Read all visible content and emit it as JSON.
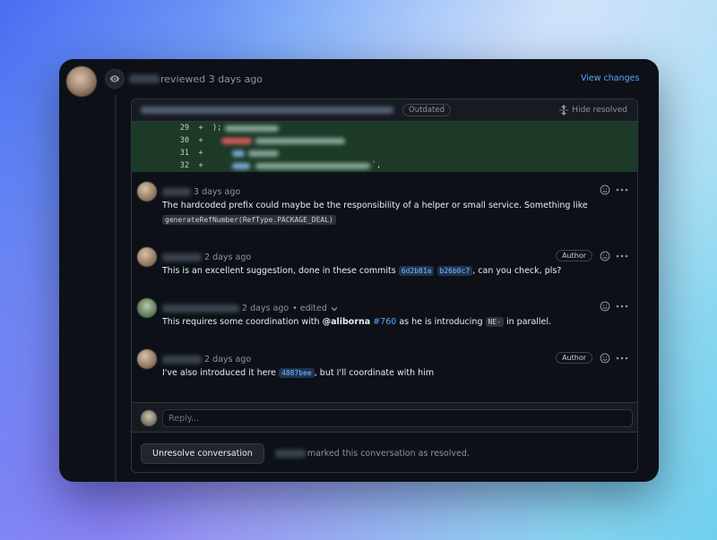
{
  "review": {
    "action_text": "reviewed 3 days ago",
    "view_changes_label": "View changes"
  },
  "file": {
    "outdated_label": "Outdated",
    "hide_resolved_label": "Hide resolved",
    "diff_lines": [
      {
        "number": "29",
        "marker": "+"
      },
      {
        "number": "30",
        "marker": "+"
      },
      {
        "number": "31",
        "marker": "+"
      },
      {
        "number": "32",
        "marker": "+"
      }
    ],
    "line32_suffix": "`,"
  },
  "comments": [
    {
      "meta": "3 days ago",
      "body_text": "The hardcoded prefix could maybe be the responsibility of a helper or small service. Something like",
      "code": "generateRefNumber(RefType.PACKAGE_DEAL)"
    },
    {
      "meta": "2 days ago",
      "author_badge": "Author",
      "body_prefix": "This is an excellent suggestion, done in these commits",
      "sha1": "6d2b81a",
      "sha2": "b26b0c7",
      "body_suffix": ", can you check, pls?"
    },
    {
      "meta": "2 days ago",
      "edited": "• edited",
      "body_prefix": "This requires some coordination with",
      "mention": "@aliborna",
      "issue": "#760",
      "body_mid": "as he is introducing",
      "code": "NE-",
      "body_suffix": "in parallel."
    },
    {
      "meta": "2 days ago",
      "author_badge": "Author",
      "body_prefix": "I've also introduced it here",
      "sha": "4887bee",
      "body_suffix": ", but I'll coordinate with him"
    }
  ],
  "reply": {
    "placeholder": "Reply..."
  },
  "resolve": {
    "button_label": "Unresolve conversation",
    "status_text": "marked this conversation as resolved."
  },
  "icons": [
    "eye-icon",
    "unfold-icon",
    "smiley-icon",
    "kebab-icon",
    "chevron-down-icon"
  ],
  "colors": {
    "background": "#0d1117",
    "accent": "#58a6ff",
    "diff_added": "#1c3a27"
  }
}
